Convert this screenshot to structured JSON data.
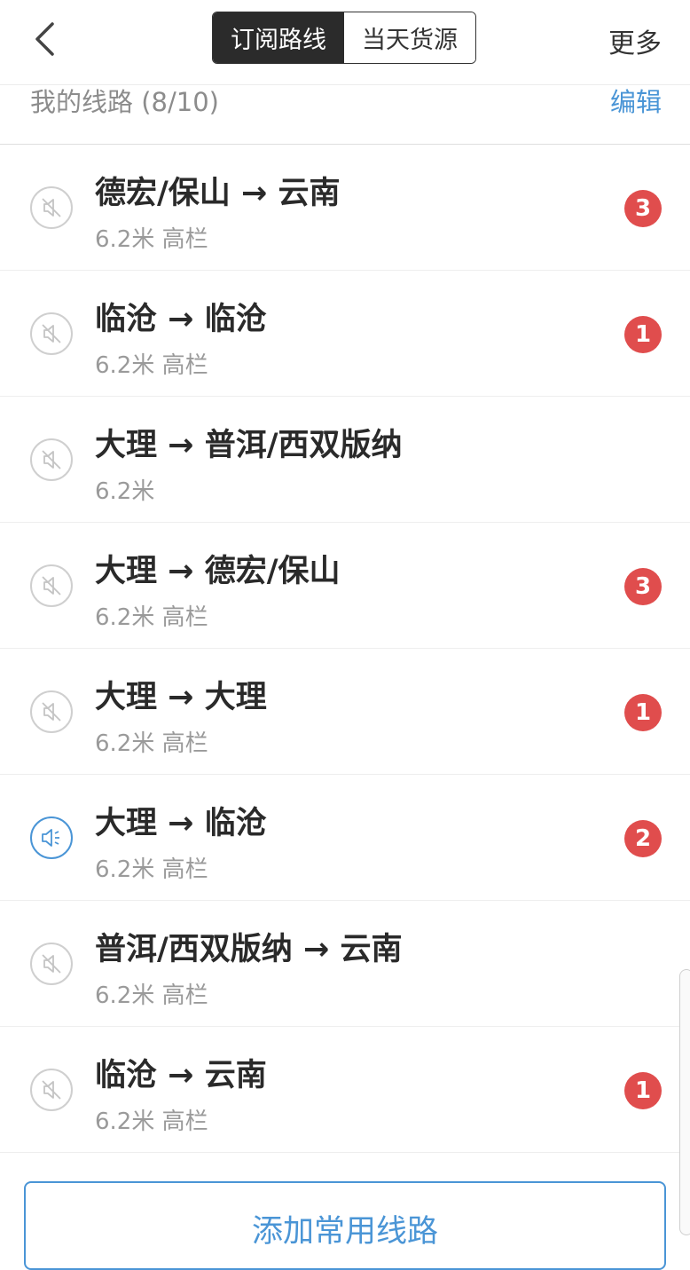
{
  "header": {
    "tabs": [
      {
        "label": "订阅路线",
        "active": true
      },
      {
        "label": "当天货源",
        "active": false
      }
    ],
    "more_label": "更多"
  },
  "section": {
    "title": "我的线路 (8/10)",
    "edit_label": "编辑"
  },
  "routes": [
    {
      "route": "德宏/保山 → 云南",
      "spec": "6.2米 高栏",
      "badge": "3",
      "sound": "off"
    },
    {
      "route": "临沧 → 临沧",
      "spec": "6.2米 高栏",
      "badge": "1",
      "sound": "off"
    },
    {
      "route": "大理 → 普洱/西双版纳",
      "spec": "6.2米",
      "badge": "",
      "sound": "off"
    },
    {
      "route": "大理 → 德宏/保山",
      "spec": "6.2米 高栏",
      "badge": "3",
      "sound": "off"
    },
    {
      "route": "大理 → 大理",
      "spec": "6.2米 高栏",
      "badge": "1",
      "sound": "off"
    },
    {
      "route": "大理 → 临沧",
      "spec": "6.2米 高栏",
      "badge": "2",
      "sound": "on"
    },
    {
      "route": "普洱/西双版纳 → 云南",
      "spec": "6.2米 高栏",
      "badge": "",
      "sound": "off"
    },
    {
      "route": "临沧 → 云南",
      "spec": "6.2米 高栏",
      "badge": "1",
      "sound": "off"
    }
  ],
  "add_button_label": "添加常用线路",
  "colors": {
    "accent": "#4a95d6",
    "badge": "#e04d4d",
    "active_tab": "#2b2b2b"
  }
}
